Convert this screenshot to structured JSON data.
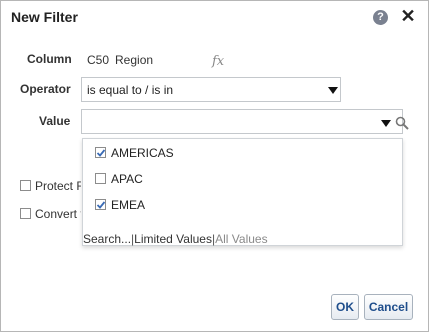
{
  "dialog": {
    "title": "New Filter",
    "help_icon_glyph": "?",
    "close_icon_glyph": "✕"
  },
  "column": {
    "label": "Column",
    "prefix": "C50",
    "name": "Region",
    "fx_icon_glyph": "fx"
  },
  "operator": {
    "label": "Operator",
    "value": "is equal to / is in"
  },
  "value_field": {
    "label": "Value",
    "text": ""
  },
  "dropdown": {
    "options": [
      {
        "label": "AMERICAS",
        "checked": true
      },
      {
        "label": "APAC",
        "checked": false
      },
      {
        "label": "EMEA",
        "checked": true
      }
    ],
    "search_link": "Search...",
    "separator": "|",
    "limited_values": "Limited Values",
    "all_values": "All Values"
  },
  "options": {
    "protect_filter_label": "Protect F",
    "convert_label": "Convert t"
  },
  "buttons": {
    "ok": "OK",
    "cancel": "Cancel"
  },
  "colors": {
    "button_text": "#1f4e8c",
    "check_blue": "#3a6bb5",
    "muted_link": "#8a8a8a"
  }
}
